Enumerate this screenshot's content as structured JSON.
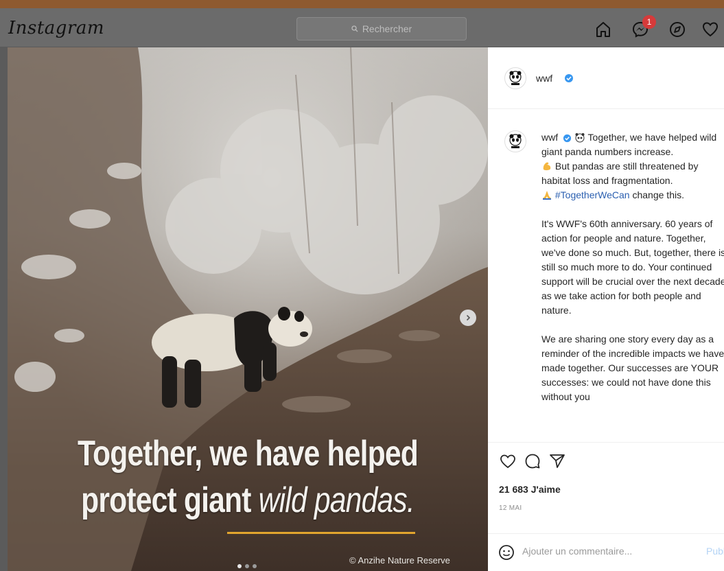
{
  "app": {
    "logo_text": "Instagram"
  },
  "search": {
    "placeholder": "Rechercher"
  },
  "nav": {
    "icons": [
      "home-icon",
      "messenger-icon",
      "explore-icon",
      "heart-icon"
    ],
    "message_badge": "1"
  },
  "post": {
    "image": {
      "headline_line1": "Together, we have helped",
      "headline_line2_plain": "protect giant ",
      "headline_line2_italic": "wild pandas.",
      "credit": "© Anzihe Nature Reserve",
      "carousel": {
        "count": 3,
        "active_index": 0
      }
    },
    "author": {
      "username": "wwf",
      "verified": true
    },
    "caption": {
      "username": "wwf",
      "line1": "Together, we have helped wild giant panda numbers increase.",
      "line2": "But pandas are still threatened by habitat loss and fragmentation.",
      "hashtag": "#TogetherWeCan",
      "line3_rest": " change this.",
      "para2": "It's WWF's 60th anniversary. 60 years of action for people and nature. Together, we've done so much. But, together, there is still so much more to do. Your continued support will be crucial over the next decade as we take action for both people and nature.",
      "para3": "We are sharing one story every day as a reminder of the incredible impacts we have made together. Our successes are YOUR successes: we could not have done this without you"
    },
    "likes": "21 683 J'aime",
    "date": "12 MAI",
    "comment": {
      "placeholder": "Ajouter un commentaire...",
      "publish_label": "Publier"
    }
  },
  "colors": {
    "accent_underline": "#e2a52e",
    "hashtag": "#2a5fb0",
    "badge": "#d63a3a",
    "verified": "#3897f0"
  }
}
